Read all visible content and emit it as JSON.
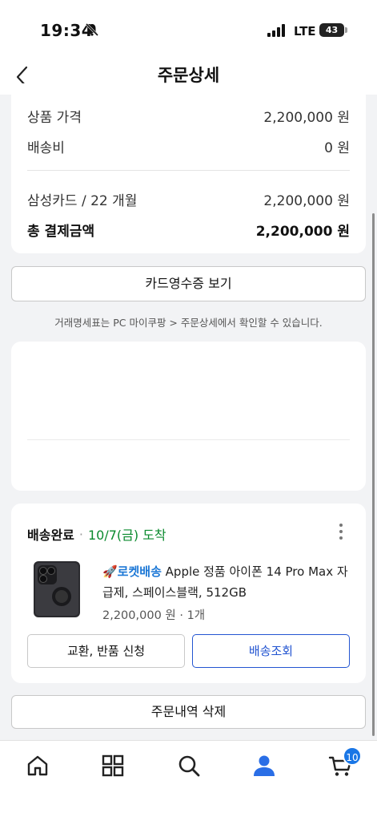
{
  "status_bar": {
    "time": "19:34",
    "network": "LTE",
    "battery": "43"
  },
  "header": {
    "title": "주문상세"
  },
  "price_summary": {
    "rows": [
      {
        "label": "상품 가격",
        "value": "2,200,000 원"
      },
      {
        "label": "배송비",
        "value": "0 원"
      },
      {
        "label": "삼성카드 / 22 개월",
        "value": "2,200,000 원"
      }
    ],
    "total_label": "총 결제금액",
    "total_value": "2,200,000 원"
  },
  "receipt_button": "카드영수증 보기",
  "notice": "거래명세표는 PC 마이쿠팡 > 주문상세에서 확인할 수 있습니다.",
  "delivery": {
    "status": "배송완료",
    "separator": "·",
    "arrival": "10/7(금) 도착",
    "rocket_label": "🚀로켓배송",
    "product_name": " Apple 정품 아이폰 14 Pro Max 자급제, 스페이스블랙, 512GB",
    "product_meta": "2,200,000 원 · 1개",
    "exchange_button": "교환, 반품 신청",
    "track_button": "배송조회"
  },
  "delete_button": "주문내역 삭제",
  "tab_bar": {
    "items": [
      "home-icon",
      "category-grid-icon",
      "search-icon",
      "my-account-icon",
      "cart-icon"
    ],
    "cart_badge": "10"
  },
  "colors": {
    "accent_blue": "#2355d1",
    "arrival_green": "#0a8a2e",
    "badge_blue": "#1976e6"
  }
}
